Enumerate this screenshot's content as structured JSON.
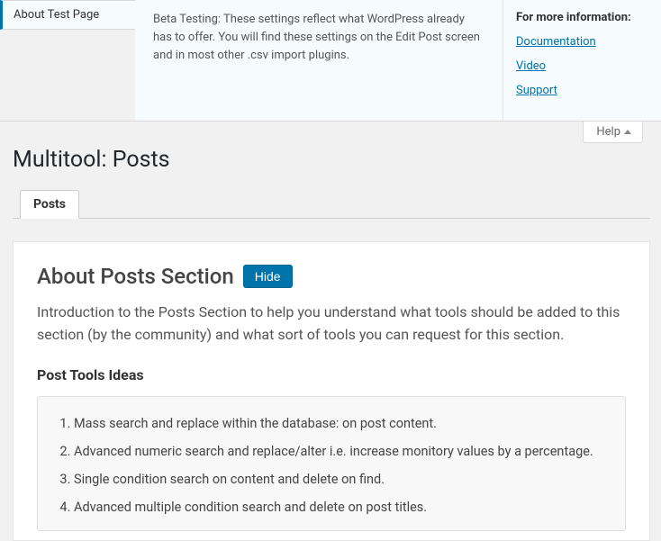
{
  "help_panel": {
    "tab_label": "About Test Page",
    "content_text": "Beta Testing: These settings reflect what WordPress already has to offer. You will find these settings on the Edit Post screen and in most other .csv import plugins.",
    "sidebar_heading": "For more information:",
    "links": {
      "documentation": "Documentation",
      "video": "Video",
      "support": "Support"
    }
  },
  "help_toggle_label": "Help",
  "page_title": "Multitool: Posts",
  "tabs": {
    "posts": "Posts"
  },
  "section": {
    "title": "About Posts Section",
    "hide_label": "Hide",
    "intro": "Introduction to the Posts Section to help you understand what tools should be added to this section (by the community) and what sort of tools you can request for this section.",
    "ideas_heading": "Post Tools Ideas",
    "ideas": [
      "Mass search and replace within the database: on post content.",
      "Advanced numeric search and replace/alter i.e. increase monitory values by a percentage.",
      "Single condition search on content and delete on find.",
      "Advanced multiple condition search and delete on post titles."
    ]
  }
}
